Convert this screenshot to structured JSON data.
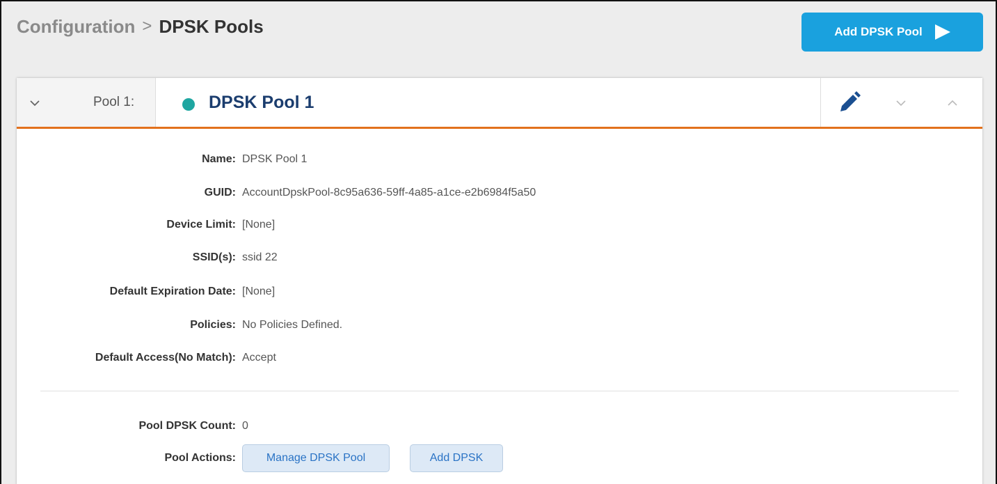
{
  "header": {
    "breadcrumb_root": "Configuration",
    "breadcrumb_separator": ">",
    "page_title": "DPSK Pools",
    "add_button_label": "Add DPSK Pool"
  },
  "pool": {
    "index_label": "Pool 1:",
    "title": "DPSK Pool 1",
    "status_color": "#1fa6a1",
    "accent_color": "#e2711d",
    "fields": [
      {
        "label": "Name:",
        "value": "DPSK Pool 1"
      },
      {
        "label": "GUID:",
        "value": "AccountDpskPool-8c95a636-59ff-4a85-a1ce-e2b6984f5a50"
      },
      {
        "label": "Device Limit:",
        "value": "[None]"
      },
      {
        "label": "SSID(s):",
        "value": "ssid 22"
      },
      {
        "label": "Default Expiration Date:",
        "value": "[None]"
      },
      {
        "label": "Policies:",
        "value": "No Policies Defined."
      },
      {
        "label": "Default Access(No Match):",
        "value": "Accept"
      }
    ],
    "count_label": "Pool DPSK Count:",
    "count_value": "0",
    "actions_label": "Pool Actions:",
    "actions": {
      "manage_label": "Manage DPSK Pool",
      "add_dpsk_label": "Add DPSK"
    }
  },
  "icons": {
    "collapse": "chevron-down-icon",
    "edit": "pencil-icon",
    "move_down": "chevron-down-icon",
    "move_up": "chevron-up-icon",
    "add": "play-icon"
  },
  "colors": {
    "primary_button": "#1aa1de",
    "title_text": "#1b3d6e"
  }
}
